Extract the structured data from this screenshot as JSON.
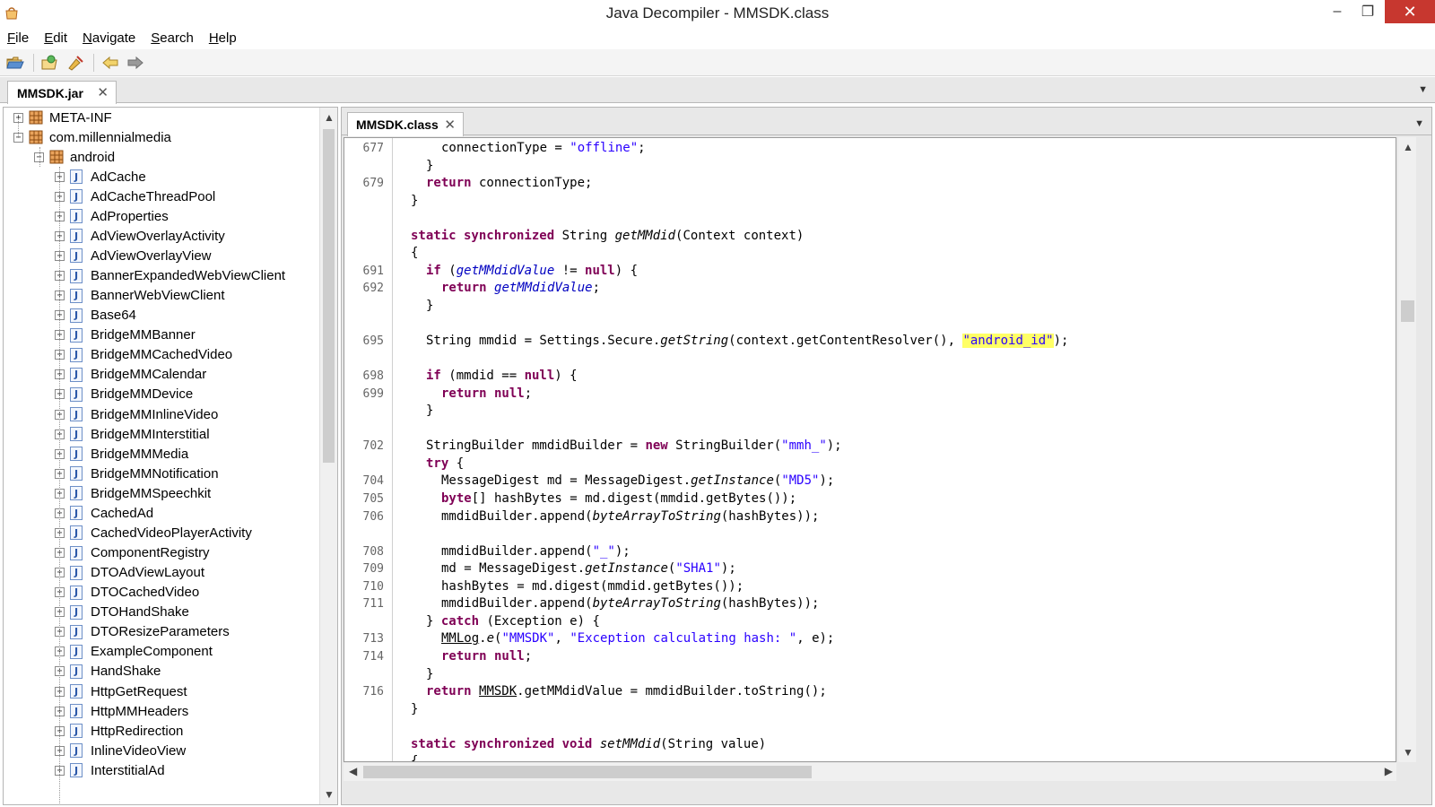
{
  "window": {
    "title": "Java Decompiler - MMSDK.class",
    "minimize": "–",
    "maximize": "❐",
    "close": "✕"
  },
  "menu": {
    "items": [
      {
        "label": "File",
        "mnemonic": "F",
        "rest": "ile"
      },
      {
        "label": "Edit",
        "mnemonic": "E",
        "rest": "dit"
      },
      {
        "label": "Navigate",
        "mnemonic": "N",
        "rest": "avigate"
      },
      {
        "label": "Search",
        "mnemonic": "S",
        "rest": "earch"
      },
      {
        "label": "Help",
        "mnemonic": "H",
        "rest": "elp"
      }
    ]
  },
  "toolbar": {
    "icons": [
      "open-folder-icon",
      "open-type-icon",
      "search-icon",
      "back-arrow-icon",
      "forward-arrow-icon"
    ]
  },
  "jar_tab": {
    "label": "MMSDK.jar",
    "close": "✕",
    "menu": "▼"
  },
  "class_tab": {
    "label": "MMSDK.class",
    "close": "✕",
    "menu": "▼"
  },
  "tree": {
    "root_items": [
      {
        "label": "META-INF",
        "expander": "+"
      },
      {
        "label": "com.millennialmedia",
        "expander": "−"
      }
    ],
    "sub_package": {
      "label": "android",
      "expander": "−"
    },
    "classes": [
      "AdCache",
      "AdCacheThreadPool",
      "AdProperties",
      "AdViewOverlayActivity",
      "AdViewOverlayView",
      "BannerExpandedWebViewClient",
      "BannerWebViewClient",
      "Base64",
      "BridgeMMBanner",
      "BridgeMMCachedVideo",
      "BridgeMMCalendar",
      "BridgeMMDevice",
      "BridgeMMInlineVideo",
      "BridgeMMInterstitial",
      "BridgeMMMedia",
      "BridgeMMNotification",
      "BridgeMMSpeechkit",
      "CachedAd",
      "CachedVideoPlayerActivity",
      "ComponentRegistry",
      "DTOAdViewLayout",
      "DTOCachedVideo",
      "DTOHandShake",
      "DTOResizeParameters",
      "ExampleComponent",
      "HandShake",
      "HttpGetRequest",
      "HttpMMHeaders",
      "HttpRedirection",
      "InlineVideoView",
      "InterstitialAd"
    ],
    "class_icon_letter": "J"
  },
  "code": {
    "line_numbers": [
      {
        "n": "677",
        "row": 0
      },
      {
        "n": "679",
        "row": 2
      },
      {
        "n": "691",
        "row": 7
      },
      {
        "n": "692",
        "row": 8
      },
      {
        "n": "695",
        "row": 11
      },
      {
        "n": "698",
        "row": 13
      },
      {
        "n": "699",
        "row": 14
      },
      {
        "n": "702",
        "row": 17
      },
      {
        "n": "704",
        "row": 19
      },
      {
        "n": "705",
        "row": 20
      },
      {
        "n": "706",
        "row": 21
      },
      {
        "n": "708",
        "row": 23
      },
      {
        "n": "709",
        "row": 24
      },
      {
        "n": "710",
        "row": 25
      },
      {
        "n": "711",
        "row": 26
      },
      {
        "n": "713",
        "row": 28
      },
      {
        "n": "714",
        "row": 29
      },
      {
        "n": "716",
        "row": 31
      }
    ],
    "lines": [
      {
        "row": 0,
        "indent": 2,
        "tokens": [
          [
            "t",
            "connectionType = "
          ],
          [
            "s",
            "\"offline\""
          ],
          [
            "t",
            ";"
          ]
        ]
      },
      {
        "row": 1,
        "indent": 1,
        "tokens": [
          [
            "t",
            "}"
          ]
        ]
      },
      {
        "row": 2,
        "indent": 1,
        "tokens": [
          [
            "k",
            "return"
          ],
          [
            "t",
            " connectionType;"
          ]
        ]
      },
      {
        "row": 3,
        "indent": 0,
        "tokens": [
          [
            "t",
            "}"
          ]
        ]
      },
      {
        "row": 5,
        "indent": 0,
        "tokens": [
          [
            "k",
            "static synchronized"
          ],
          [
            "t",
            " String "
          ],
          [
            "i",
            "getMMdid"
          ],
          [
            "t",
            "(Context context)"
          ]
        ]
      },
      {
        "row": 6,
        "indent": 0,
        "tokens": [
          [
            "t",
            "{"
          ]
        ]
      },
      {
        "row": 7,
        "indent": 1,
        "tokens": [
          [
            "k",
            "if"
          ],
          [
            "t",
            " ("
          ],
          [
            "f",
            "getMMdidValue"
          ],
          [
            "t",
            " != "
          ],
          [
            "k",
            "null"
          ],
          [
            "t",
            ") {"
          ]
        ]
      },
      {
        "row": 8,
        "indent": 2,
        "tokens": [
          [
            "k",
            "return"
          ],
          [
            "t",
            " "
          ],
          [
            "f",
            "getMMdidValue"
          ],
          [
            "t",
            ";"
          ]
        ]
      },
      {
        "row": 9,
        "indent": 1,
        "tokens": [
          [
            "t",
            "}"
          ]
        ]
      },
      {
        "row": 11,
        "indent": 1,
        "tokens": [
          [
            "t",
            "String mmdid = Settings.Secure."
          ],
          [
            "i",
            "getString"
          ],
          [
            "t",
            "(context.getContentResolver(), "
          ],
          [
            "h",
            "\"android_id\""
          ],
          [
            "t",
            ");"
          ]
        ]
      },
      {
        "row": 13,
        "indent": 1,
        "tokens": [
          [
            "k",
            "if"
          ],
          [
            "t",
            " (mmdid == "
          ],
          [
            "k",
            "null"
          ],
          [
            "t",
            ") {"
          ]
        ]
      },
      {
        "row": 14,
        "indent": 2,
        "tokens": [
          [
            "k",
            "return null"
          ],
          [
            "t",
            ";"
          ]
        ]
      },
      {
        "row": 15,
        "indent": 1,
        "tokens": [
          [
            "t",
            "}"
          ]
        ]
      },
      {
        "row": 17,
        "indent": 1,
        "tokens": [
          [
            "t",
            "StringBuilder mmdidBuilder = "
          ],
          [
            "k",
            "new"
          ],
          [
            "t",
            " StringBuilder("
          ],
          [
            "s",
            "\"mmh_\""
          ],
          [
            "t",
            ");"
          ]
        ]
      },
      {
        "row": 18,
        "indent": 1,
        "tokens": [
          [
            "k",
            "try"
          ],
          [
            "t",
            " {"
          ]
        ]
      },
      {
        "row": 19,
        "indent": 2,
        "tokens": [
          [
            "t",
            "MessageDigest md = MessageDigest."
          ],
          [
            "i",
            "getInstance"
          ],
          [
            "t",
            "("
          ],
          [
            "s",
            "\"MD5\""
          ],
          [
            "t",
            ");"
          ]
        ]
      },
      {
        "row": 20,
        "indent": 2,
        "tokens": [
          [
            "k",
            "byte"
          ],
          [
            "t",
            "[] hashBytes = md.digest(mmdid.getBytes());"
          ]
        ]
      },
      {
        "row": 21,
        "indent": 2,
        "tokens": [
          [
            "t",
            "mmdidBuilder.append("
          ],
          [
            "i",
            "byteArrayToString"
          ],
          [
            "t",
            "(hashBytes));"
          ]
        ]
      },
      {
        "row": 23,
        "indent": 2,
        "tokens": [
          [
            "t",
            "mmdidBuilder.append("
          ],
          [
            "s",
            "\"_\""
          ],
          [
            "t",
            ");"
          ]
        ]
      },
      {
        "row": 24,
        "indent": 2,
        "tokens": [
          [
            "t",
            "md = MessageDigest."
          ],
          [
            "i",
            "getInstance"
          ],
          [
            "t",
            "("
          ],
          [
            "s",
            "\"SHA1\""
          ],
          [
            "t",
            ");"
          ]
        ]
      },
      {
        "row": 25,
        "indent": 2,
        "tokens": [
          [
            "t",
            "hashBytes = md.digest(mmdid.getBytes());"
          ]
        ]
      },
      {
        "row": 26,
        "indent": 2,
        "tokens": [
          [
            "t",
            "mmdidBuilder.append("
          ],
          [
            "i",
            "byteArrayToString"
          ],
          [
            "t",
            "(hashBytes));"
          ]
        ]
      },
      {
        "row": 27,
        "indent": 1,
        "tokens": [
          [
            "t",
            "} "
          ],
          [
            "k",
            "catch"
          ],
          [
            "t",
            " (Exception e) {"
          ]
        ]
      },
      {
        "row": 28,
        "indent": 2,
        "tokens": [
          [
            "u",
            "MMLog"
          ],
          [
            "t",
            "."
          ],
          [
            "i",
            "e"
          ],
          [
            "t",
            "("
          ],
          [
            "s",
            "\"MMSDK\""
          ],
          [
            "t",
            ", "
          ],
          [
            "s",
            "\"Exception calculating hash: \""
          ],
          [
            "t",
            ", e);"
          ]
        ]
      },
      {
        "row": 29,
        "indent": 2,
        "tokens": [
          [
            "k",
            "return null"
          ],
          [
            "t",
            ";"
          ]
        ]
      },
      {
        "row": 30,
        "indent": 1,
        "tokens": [
          [
            "t",
            "}"
          ]
        ]
      },
      {
        "row": 31,
        "indent": 1,
        "tokens": [
          [
            "k",
            "return"
          ],
          [
            "t",
            " "
          ],
          [
            "u",
            "MMSDK"
          ],
          [
            "t",
            ".getMMdidValue = mmdidBuilder.toString();"
          ]
        ]
      },
      {
        "row": 32,
        "indent": 0,
        "tokens": [
          [
            "t",
            "}"
          ]
        ]
      },
      {
        "row": 34,
        "indent": 0,
        "tokens": [
          [
            "k",
            "static synchronized void"
          ],
          [
            "t",
            " "
          ],
          [
            "i",
            "setMMdid"
          ],
          [
            "t",
            "(String value)"
          ]
        ]
      },
      {
        "row": 35,
        "indent": 0,
        "tokens": [
          [
            "t",
            "{"
          ]
        ]
      }
    ]
  },
  "colors": {
    "keyword": "#7f0055",
    "string": "#2a00ff",
    "field": "#0000c0",
    "highlight": "#ffff66",
    "close_button": "#c7372f"
  }
}
